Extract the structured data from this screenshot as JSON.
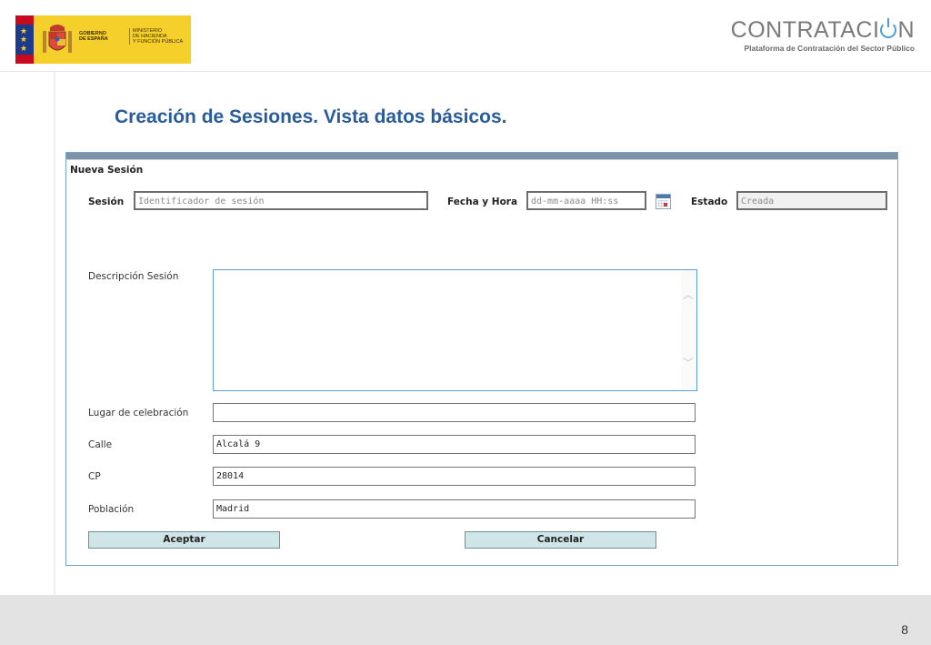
{
  "header": {
    "gov_logo": {
      "line1": "GOBIERNO",
      "line2": "DE ESPAÑA",
      "min1": "MINISTERIO",
      "min2": "DE HACIENDA",
      "min3": "Y FUNCIÓN PÚBLICA"
    },
    "brand": {
      "name_part1": "CONTRATACI",
      "name_part2": "N",
      "subtitle": "Plataforma de Contratación del Sector Público"
    }
  },
  "slide": {
    "title": "Creación de Sesiones. Vista datos básicos.",
    "page_number": "8"
  },
  "form": {
    "heading": "Nueva Sesión",
    "session": {
      "label": "Sesión",
      "placeholder": "Identificador de sesión"
    },
    "datetime": {
      "label": "Fecha y Hora",
      "placeholder": "dd-mm-aaaa HH:ss"
    },
    "status": {
      "label": "Estado",
      "value": "Creada"
    },
    "description": {
      "label": "Descripción Sesión",
      "value": ""
    },
    "place": {
      "label": "Lugar de celebración",
      "value": ""
    },
    "street": {
      "label": "Calle",
      "value": "Alcalá 9"
    },
    "postal_code": {
      "label": "CP",
      "value": "28014"
    },
    "town": {
      "label": "Población",
      "value": "Madrid"
    },
    "accept_label": "Aceptar",
    "cancel_label": "Cancelar"
  },
  "colors": {
    "title": "#2a5c9a",
    "button_bg": "#cfe5e7",
    "form_border": "#6ea6d1",
    "gov_yellow": "#f5d02b"
  }
}
